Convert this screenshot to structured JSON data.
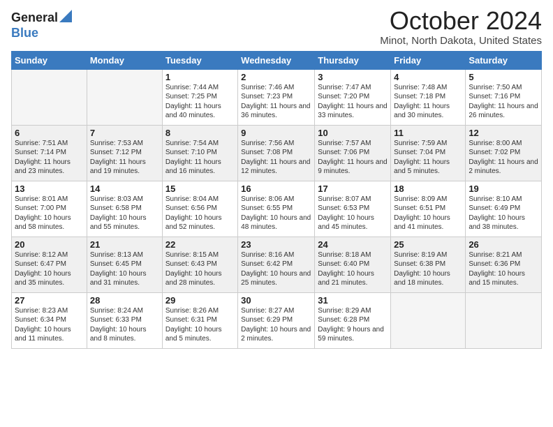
{
  "header": {
    "logo_general": "General",
    "logo_blue": "Blue",
    "title": "October 2024",
    "subtitle": "Minot, North Dakota, United States"
  },
  "weekdays": [
    "Sunday",
    "Monday",
    "Tuesday",
    "Wednesday",
    "Thursday",
    "Friday",
    "Saturday"
  ],
  "weeks": [
    [
      {
        "day": "",
        "info": ""
      },
      {
        "day": "",
        "info": ""
      },
      {
        "day": "1",
        "info": "Sunrise: 7:44 AM\nSunset: 7:25 PM\nDaylight: 11 hours and 40 minutes."
      },
      {
        "day": "2",
        "info": "Sunrise: 7:46 AM\nSunset: 7:23 PM\nDaylight: 11 hours and 36 minutes."
      },
      {
        "day": "3",
        "info": "Sunrise: 7:47 AM\nSunset: 7:20 PM\nDaylight: 11 hours and 33 minutes."
      },
      {
        "day": "4",
        "info": "Sunrise: 7:48 AM\nSunset: 7:18 PM\nDaylight: 11 hours and 30 minutes."
      },
      {
        "day": "5",
        "info": "Sunrise: 7:50 AM\nSunset: 7:16 PM\nDaylight: 11 hours and 26 minutes."
      }
    ],
    [
      {
        "day": "6",
        "info": "Sunrise: 7:51 AM\nSunset: 7:14 PM\nDaylight: 11 hours and 23 minutes."
      },
      {
        "day": "7",
        "info": "Sunrise: 7:53 AM\nSunset: 7:12 PM\nDaylight: 11 hours and 19 minutes."
      },
      {
        "day": "8",
        "info": "Sunrise: 7:54 AM\nSunset: 7:10 PM\nDaylight: 11 hours and 16 minutes."
      },
      {
        "day": "9",
        "info": "Sunrise: 7:56 AM\nSunset: 7:08 PM\nDaylight: 11 hours and 12 minutes."
      },
      {
        "day": "10",
        "info": "Sunrise: 7:57 AM\nSunset: 7:06 PM\nDaylight: 11 hours and 9 minutes."
      },
      {
        "day": "11",
        "info": "Sunrise: 7:59 AM\nSunset: 7:04 PM\nDaylight: 11 hours and 5 minutes."
      },
      {
        "day": "12",
        "info": "Sunrise: 8:00 AM\nSunset: 7:02 PM\nDaylight: 11 hours and 2 minutes."
      }
    ],
    [
      {
        "day": "13",
        "info": "Sunrise: 8:01 AM\nSunset: 7:00 PM\nDaylight: 10 hours and 58 minutes."
      },
      {
        "day": "14",
        "info": "Sunrise: 8:03 AM\nSunset: 6:58 PM\nDaylight: 10 hours and 55 minutes."
      },
      {
        "day": "15",
        "info": "Sunrise: 8:04 AM\nSunset: 6:56 PM\nDaylight: 10 hours and 52 minutes."
      },
      {
        "day": "16",
        "info": "Sunrise: 8:06 AM\nSunset: 6:55 PM\nDaylight: 10 hours and 48 minutes."
      },
      {
        "day": "17",
        "info": "Sunrise: 8:07 AM\nSunset: 6:53 PM\nDaylight: 10 hours and 45 minutes."
      },
      {
        "day": "18",
        "info": "Sunrise: 8:09 AM\nSunset: 6:51 PM\nDaylight: 10 hours and 41 minutes."
      },
      {
        "day": "19",
        "info": "Sunrise: 8:10 AM\nSunset: 6:49 PM\nDaylight: 10 hours and 38 minutes."
      }
    ],
    [
      {
        "day": "20",
        "info": "Sunrise: 8:12 AM\nSunset: 6:47 PM\nDaylight: 10 hours and 35 minutes."
      },
      {
        "day": "21",
        "info": "Sunrise: 8:13 AM\nSunset: 6:45 PM\nDaylight: 10 hours and 31 minutes."
      },
      {
        "day": "22",
        "info": "Sunrise: 8:15 AM\nSunset: 6:43 PM\nDaylight: 10 hours and 28 minutes."
      },
      {
        "day": "23",
        "info": "Sunrise: 8:16 AM\nSunset: 6:42 PM\nDaylight: 10 hours and 25 minutes."
      },
      {
        "day": "24",
        "info": "Sunrise: 8:18 AM\nSunset: 6:40 PM\nDaylight: 10 hours and 21 minutes."
      },
      {
        "day": "25",
        "info": "Sunrise: 8:19 AM\nSunset: 6:38 PM\nDaylight: 10 hours and 18 minutes."
      },
      {
        "day": "26",
        "info": "Sunrise: 8:21 AM\nSunset: 6:36 PM\nDaylight: 10 hours and 15 minutes."
      }
    ],
    [
      {
        "day": "27",
        "info": "Sunrise: 8:23 AM\nSunset: 6:34 PM\nDaylight: 10 hours and 11 minutes."
      },
      {
        "day": "28",
        "info": "Sunrise: 8:24 AM\nSunset: 6:33 PM\nDaylight: 10 hours and 8 minutes."
      },
      {
        "day": "29",
        "info": "Sunrise: 8:26 AM\nSunset: 6:31 PM\nDaylight: 10 hours and 5 minutes."
      },
      {
        "day": "30",
        "info": "Sunrise: 8:27 AM\nSunset: 6:29 PM\nDaylight: 10 hours and 2 minutes."
      },
      {
        "day": "31",
        "info": "Sunrise: 8:29 AM\nSunset: 6:28 PM\nDaylight: 9 hours and 59 minutes."
      },
      {
        "day": "",
        "info": ""
      },
      {
        "day": "",
        "info": ""
      }
    ]
  ]
}
